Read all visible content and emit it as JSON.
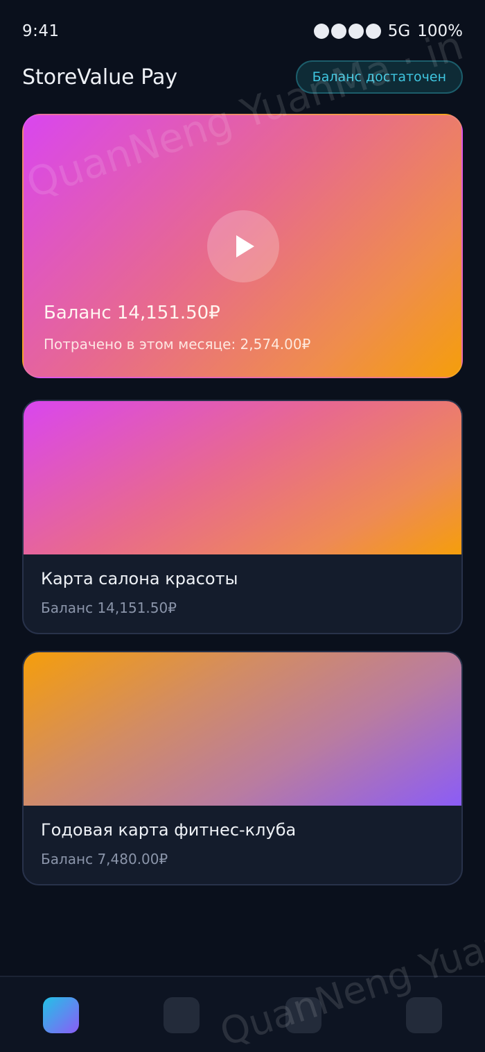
{
  "status_bar": {
    "time": "9:41",
    "network": "5G",
    "battery": "100%"
  },
  "header": {
    "app_title": "StoreValue Pay",
    "status_badge": "Баланс достаточен"
  },
  "hero_card": {
    "balance": "Баланс 14,151.50₽",
    "spent": "Потрачено в этом месяце: 2,574.00₽"
  },
  "cards": [
    {
      "name": "Карта салона красоты",
      "balance": "Баланс 14,151.50₽"
    },
    {
      "name": "Годовая карта фитнес-клуба",
      "balance": "Баланс 7,480.00₽"
    }
  ],
  "watermark": {
    "line1": "QuanNeng YuanMa · in",
    "line2": "QuanNeng YuanMa"
  },
  "colors": {
    "background": "#0a101c",
    "accent": "#3fc6e0",
    "gradient_pink": "#d946ef",
    "gradient_orange": "#f59e0b",
    "gradient_purple": "#8b5cf6"
  },
  "icons": [
    "play-icon",
    "signal-dots-icon"
  ]
}
